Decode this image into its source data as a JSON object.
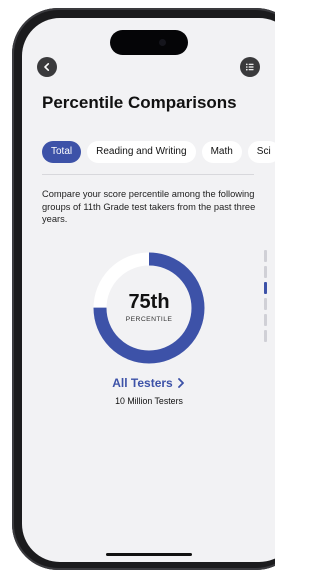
{
  "header": {
    "title": "Percentile Comparisons",
    "back_icon": "chevron-left-icon",
    "menu_icon": "list-icon"
  },
  "tabs": [
    {
      "label": "Total",
      "active": true
    },
    {
      "label": "Reading and Writing",
      "active": false
    },
    {
      "label": "Math",
      "active": false
    },
    {
      "label": "Sci",
      "active": false
    }
  ],
  "description": "Compare your score percentile among the following groups of 11th Grade test takers from the past three years.",
  "percentile": {
    "value": "75th",
    "caption": "PERCENTILE",
    "fraction": 0.75
  },
  "group": {
    "label": "All Testers",
    "link_icon": "chevron-right-icon",
    "count": "10 Million Testers"
  },
  "pager": {
    "total": 6,
    "active_index": 2
  },
  "colors": {
    "accent": "#3d52a8",
    "track": "#ffffff",
    "screen_bg": "#f2f2f4",
    "frame": "#1b1b1d"
  }
}
